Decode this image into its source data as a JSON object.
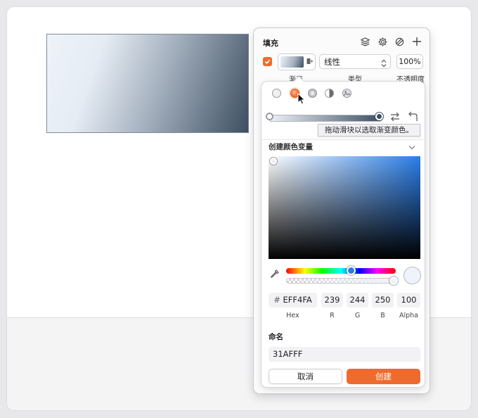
{
  "canvas": {
    "gradient_colors": [
      "#eef3fa",
      "#a5b1bf",
      "#3d4f61"
    ]
  },
  "panel": {
    "title": "填充",
    "header_icons": [
      "layers-icon",
      "gear-icon",
      "style-icon",
      "plus-icon"
    ],
    "fill": {
      "enabled": true,
      "type_value": "线性",
      "opacity": "100%",
      "labels": {
        "swatch": "渐变",
        "type": "类型",
        "opacity": "不透明度"
      }
    }
  },
  "popover": {
    "gradient_types": [
      "solid",
      "linear",
      "radial",
      "angular",
      "image"
    ],
    "selected_type": "linear",
    "tooltip": "拖动滑块以选取渐变颜色。",
    "section_title": "创建颜色变量",
    "hex": "EFF4FA",
    "hex_prefix": "#",
    "r": "239",
    "g": "244",
    "b": "250",
    "alpha": "100",
    "labels": {
      "hex": "Hex",
      "r": "R",
      "g": "G",
      "b": "B",
      "alpha": "Alpha"
    },
    "name_title": "命名",
    "name_value": "31AFFF",
    "cancel_label": "取消",
    "create_label": "创建",
    "accent_color": "#ee6b2f"
  }
}
